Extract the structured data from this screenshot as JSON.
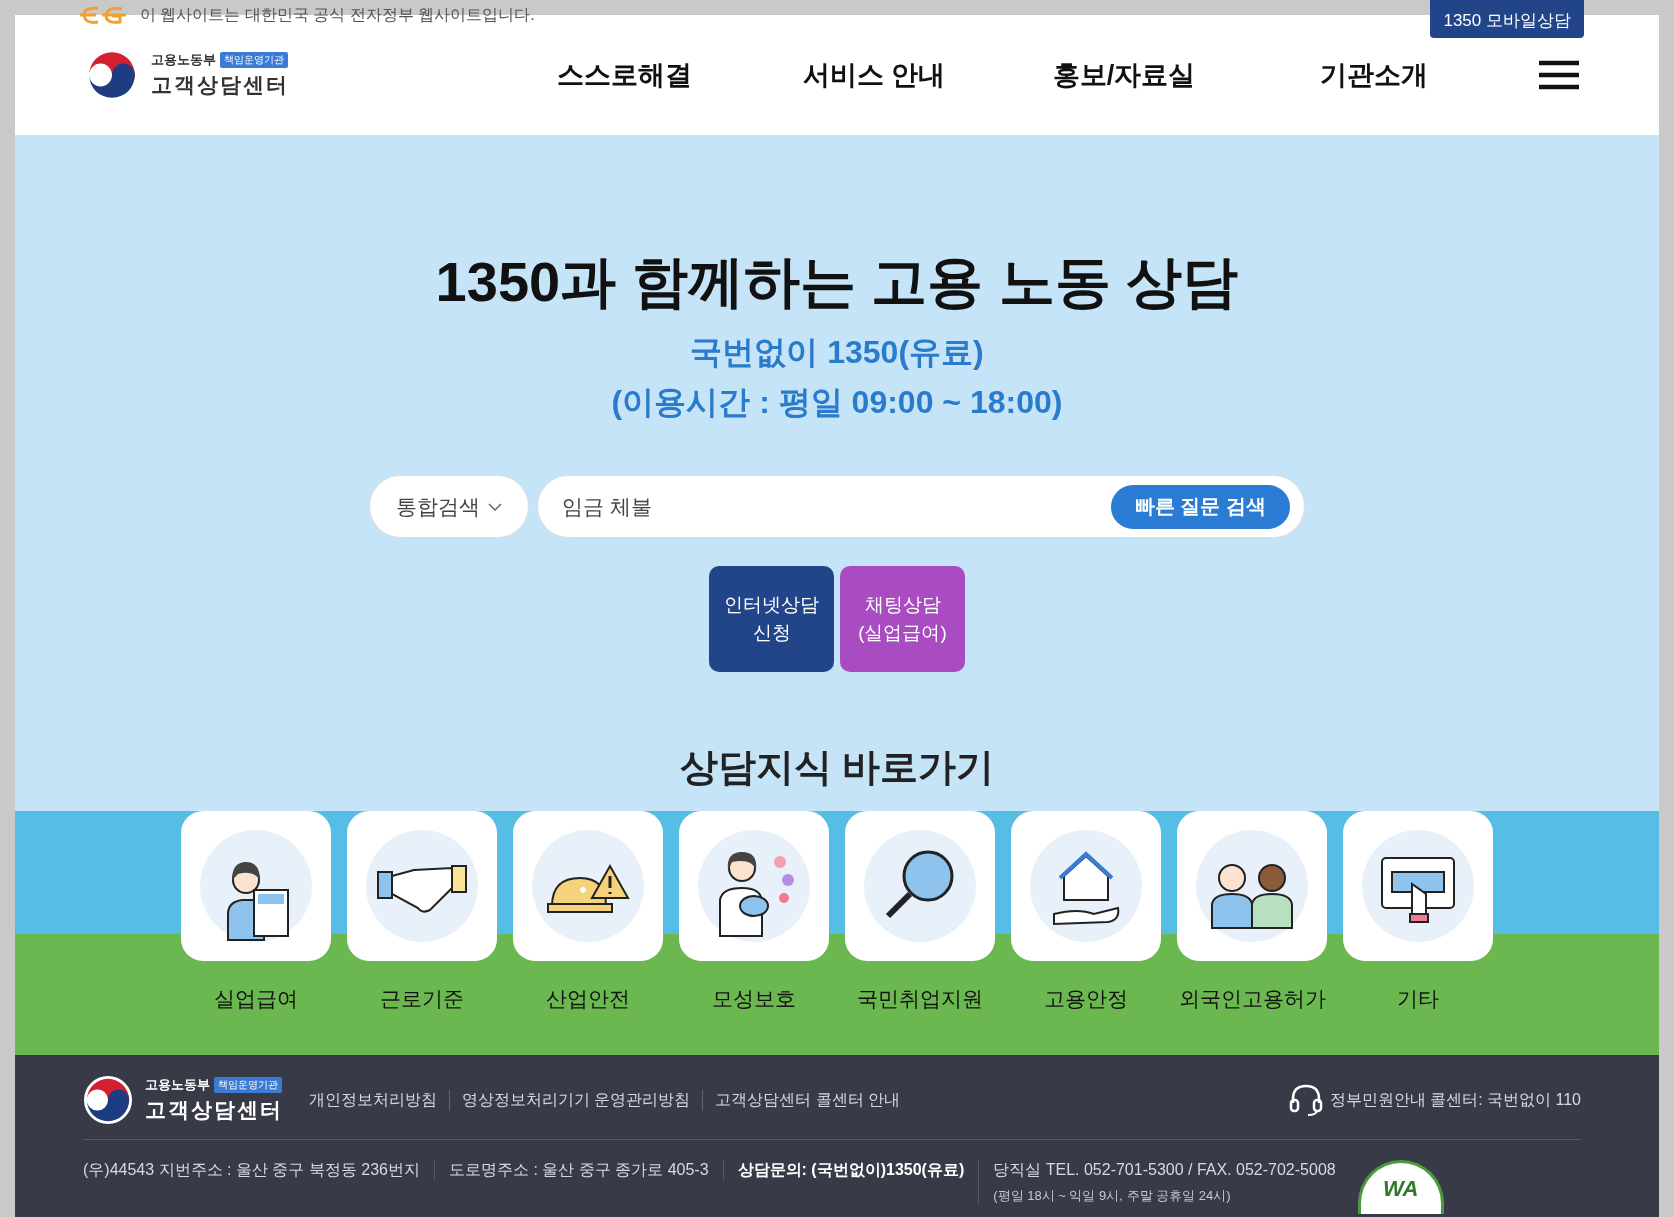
{
  "notice": "이 웹사이트는 대한민국 공식 전자정부 웹사이트입니다.",
  "mobile_button": "1350 모바일상담",
  "logo": {
    "ministry": "고용노동부",
    "badge": "책임운영기관",
    "name": "고객상담센터"
  },
  "nav": [
    "스스로해결",
    "서비스 안내",
    "홍보/자료실",
    "기관소개"
  ],
  "hero": {
    "title": "1350과 함께하는 고용 노동 상담",
    "subtitle": "국번없이 1350(유료)",
    "hours": "(이용시간 : 평일 09:00 ~ 18:00)"
  },
  "search": {
    "scope": "통합검색",
    "value": "임금 체불",
    "button": "빠른 질문 검색"
  },
  "actions": [
    {
      "lines": [
        "인터넷상담",
        "신청"
      ],
      "color": "#22458a"
    },
    {
      "lines": [
        "채팅상담",
        "(실업급여)"
      ],
      "color": "#a94bc1"
    }
  ],
  "shortcuts": {
    "title": "상담지식 바로가기",
    "items": [
      {
        "label": "실업급여",
        "kind": "benefit"
      },
      {
        "label": "근로기준",
        "kind": "handshake"
      },
      {
        "label": "산업안전",
        "kind": "safety"
      },
      {
        "label": "모성보호",
        "kind": "mother"
      },
      {
        "label": "국민취업지원",
        "kind": "search"
      },
      {
        "label": "고용안정",
        "kind": "house"
      },
      {
        "label": "외국인고용허가",
        "kind": "people"
      },
      {
        "label": "기타",
        "kind": "web"
      }
    ]
  },
  "footer": {
    "logo": {
      "ministry": "고용노동부",
      "badge": "책임운영기관",
      "name": "고객상담센터"
    },
    "links": [
      "개인정보처리방침",
      "영상정보처리기기 운영관리방침",
      "고객상담센터 콜센터 안내"
    ],
    "callcenter": "정부민원안내 콜센터: 국번없이 110",
    "address": [
      "(우)44543 지번주소 : 울산 중구 북정동 236번지",
      "도로명주소 : 울산 중구 종가로 405-3"
    ],
    "inquiry": "상담문의: (국번없이)1350(유료)",
    "duty": "당직실 TEL. 052-701-5300 / FAX. 052-702-5008",
    "duty_hours": "(평일 18시 ~ 익일 9시, 주말 공휴일 24시)",
    "wa_mark": "WA"
  }
}
